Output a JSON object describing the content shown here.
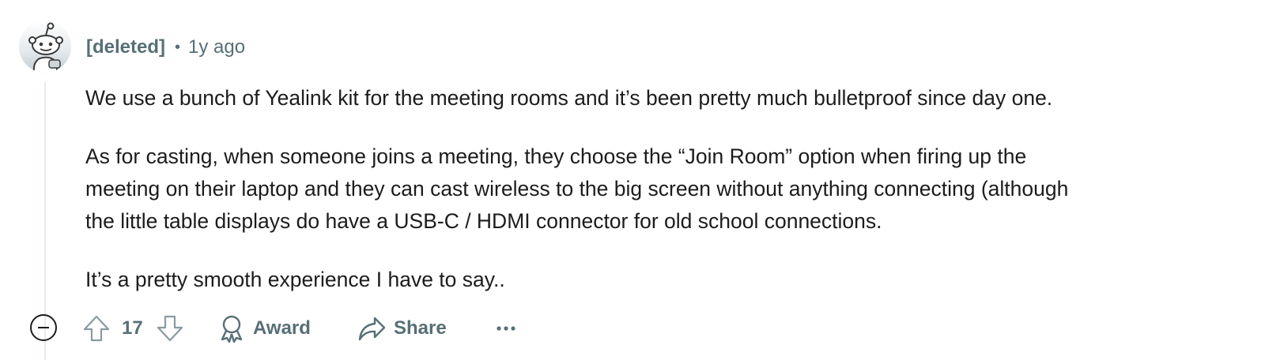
{
  "comment": {
    "author": "[deleted]",
    "separator": "•",
    "timestamp": "1y ago",
    "paragraphs": [
      [
        "We use a bunch of Yealink kit for the meeting rooms and it’s been pretty much bulletproof since day one."
      ],
      [
        "As for casting, when someone joins a meeting, they choose the “Join Room” option when firing up the",
        "meeting on their laptop and they can cast wireless to the big screen without anything connecting (although",
        "the little table displays do have a USB-C / HDMI connector for old school connections."
      ],
      [
        "It’s a pretty smooth experience I have to say.."
      ]
    ]
  },
  "actions": {
    "vote_count": "17",
    "award_label": "Award",
    "share_label": "Share",
    "more_label": "···"
  },
  "icons": {
    "avatar": "snoo-avatar-icon",
    "collapse": "collapse-minus-icon",
    "upvote": "upvote-arrow-icon",
    "downvote": "downvote-arrow-icon",
    "award": "award-ribbon-icon",
    "share": "share-arrow-icon",
    "more": "ellipsis-icon"
  },
  "colors": {
    "meta_gray": "#576f76",
    "body_text": "#1c1c1c",
    "thread_line": "#e5ebee"
  }
}
